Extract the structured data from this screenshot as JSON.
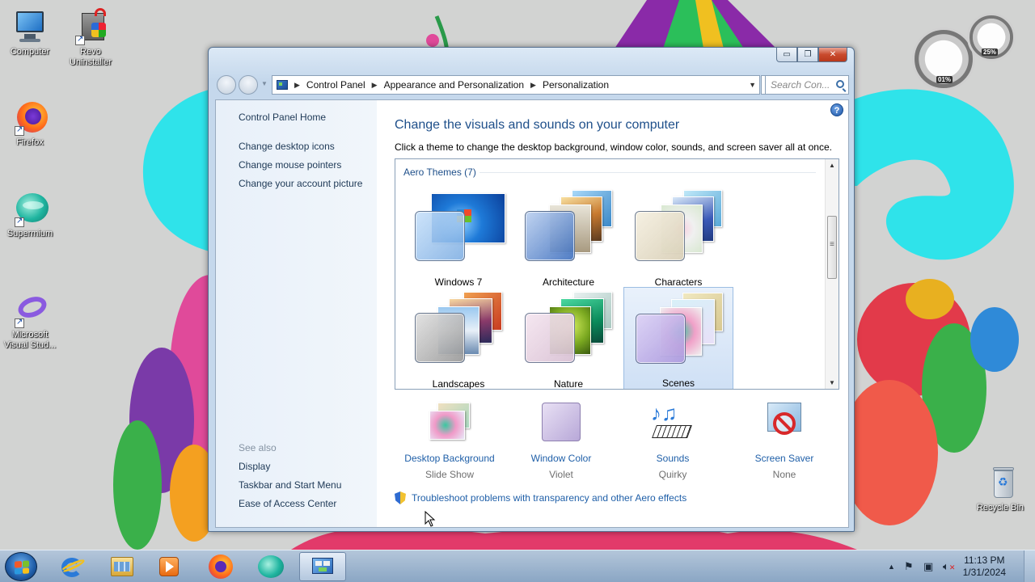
{
  "desktop": {
    "icons": [
      {
        "label": "Computer"
      },
      {
        "label": "Revo Uninstaller"
      },
      {
        "label": "Firefox"
      },
      {
        "label": "Supermium"
      },
      {
        "label": "Microsoft Visual Stud..."
      },
      {
        "label": "Recycle Bin"
      }
    ],
    "gadget": {
      "cpu": "01%",
      "mem": "25%"
    }
  },
  "window": {
    "buttons": {
      "minimize": "▭",
      "maximize": "❐",
      "close": "✕"
    },
    "breadcrumb": [
      "Control Panel",
      "Appearance and Personalization",
      "Personalization"
    ],
    "search_placeholder": "Search Con...",
    "left_pane": {
      "home": "Control Panel Home",
      "links": [
        "Change desktop icons",
        "Change mouse pointers",
        "Change your account picture"
      ],
      "see_also_label": "See also",
      "see_also": [
        "Display",
        "Taskbar and Start Menu",
        "Ease of Access Center"
      ]
    },
    "main": {
      "title": "Change the visuals and sounds on your computer",
      "subtitle": "Click a theme to change the desktop background, window color, sounds, and screen saver all at once.",
      "group_header": "Aero Themes (7)",
      "themes": [
        {
          "name": "Windows 7",
          "selected": false
        },
        {
          "name": "Architecture",
          "selected": false
        },
        {
          "name": "Characters",
          "selected": false
        },
        {
          "name": "Landscapes",
          "selected": false
        },
        {
          "name": "Nature",
          "selected": false
        },
        {
          "name": "Scenes",
          "selected": true
        }
      ],
      "settings": [
        {
          "name": "Desktop Background",
          "value": "Slide Show",
          "icon": "desktop-background-icon"
        },
        {
          "name": "Window Color",
          "value": "Violet",
          "icon": "window-color-icon"
        },
        {
          "name": "Sounds",
          "value": "Quirky",
          "icon": "sounds-icon"
        },
        {
          "name": "Screen Saver",
          "value": "None",
          "icon": "screen-saver-icon"
        }
      ],
      "troubleshoot": "Troubleshoot problems with transparency and other Aero effects",
      "help": "?"
    }
  },
  "taskbar": {
    "apps": [
      "internet-explorer",
      "windows-explorer",
      "media-player",
      "firefox",
      "supermium",
      "control-panel"
    ],
    "time": "11:13 PM",
    "date": "1/31/2024"
  },
  "colors": {
    "link": "#1f5fa8",
    "heading": "#1e4f8a",
    "aqua": "#2fe3ea",
    "violet": "#c8bde0"
  }
}
